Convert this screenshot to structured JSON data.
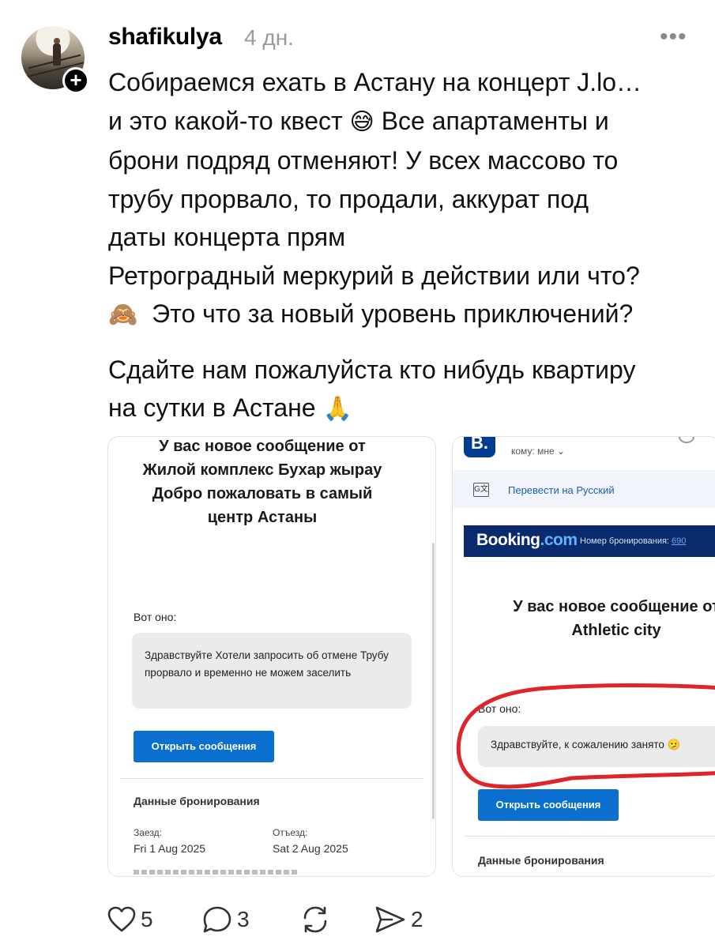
{
  "post": {
    "username": "shafikulya",
    "time": "4 дн.",
    "more_label": "•••",
    "lines": [
      "Собираемся ехать в Астану на концерт J.lo…",
      "и это какой-то квест",
      "Все апартаменты и",
      "брони подряд отменяют! У всех массово то",
      "трубу прорвало, то продали, аккурат под",
      "даты концерта прям",
      "Ретроградный меркурий в действии или что?",
      "Это что за новый уровень приключений?",
      "Сдайте нам пожалуйста кто нибудь квартиру",
      "на сутки в Астане"
    ],
    "emojis": {
      "sweat": "😅",
      "monkey": "🙈",
      "pray": "🙏"
    }
  },
  "card1": {
    "title": "У вас новое сообщение от Жилой комплекс Бухар жырау Добро пожаловать в самый центр Астаны",
    "label": "Вот оно:",
    "message": "Здравствуйте Хотели запросить об отмене Трубу прорвало и временно не можем заселить",
    "button": "Открыть сообщения",
    "booking_header": "Данные бронирования",
    "checkin_label": "Заезд:",
    "checkin_value": "Fri 1 Aug 2025",
    "checkout_label": "Отъезд:",
    "checkout_value": "Sat 2 Aug 2025"
  },
  "card2": {
    "logo": "B.",
    "to_me": "кому: мне ⌄",
    "translate": "Перевести на Русский",
    "brand_a": "Booking",
    "brand_b": ".com",
    "booking_number_label": "Номер бронирования:",
    "booking_number_value": "690",
    "title": "У вас новое сообщение от Athletic city",
    "label": "Вот оно:",
    "message": "Здравствуйте, к сожалению занято 🫤",
    "button": "Открыть сообщения",
    "booking_header": "Данные бронирования",
    "annotation_color": "#e0242b"
  },
  "actions": {
    "likes": "5",
    "comments": "3",
    "reposts": "",
    "shares": "2"
  }
}
